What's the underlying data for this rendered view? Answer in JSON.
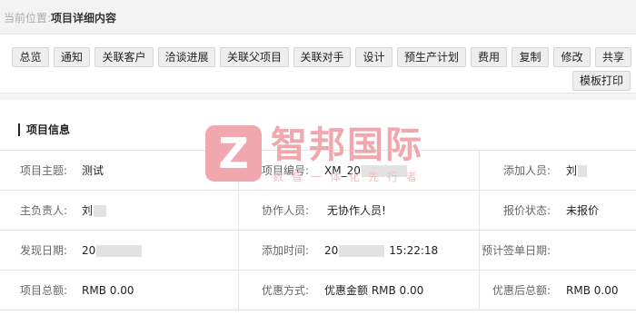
{
  "breadcrumb": {
    "prefix": "当前位置:",
    "current": "项目详细内容"
  },
  "toolbar": {
    "buttons": [
      "总览",
      "通知",
      "关联客户",
      "洽谈进展",
      "关联父项目",
      "关联对手",
      "设计",
      "预生产计划",
      "费用",
      "复制",
      "修改",
      "共享"
    ],
    "print_label": "模板打印"
  },
  "section": {
    "title": "项目信息"
  },
  "fields": {
    "project_subject": {
      "label": "项目主题:",
      "value": "测试"
    },
    "project_code": {
      "label": "项目编号:",
      "value": "XM_20"
    },
    "added_by": {
      "label": "添加人员:",
      "value": "刘"
    },
    "lead_owner": {
      "label": "主负责人:",
      "value": "刘"
    },
    "collaborators": {
      "label": "协作人员:",
      "value": "无协作人员!"
    },
    "quote_status": {
      "label": "报价状态:",
      "value": "未报价"
    },
    "found_date": {
      "label": "发现日期:",
      "value": "20"
    },
    "added_time": {
      "label": "添加时间:",
      "value": "20",
      "value_suffix": "15:22:18"
    },
    "expected_sign_date": {
      "label": "预计签单日期:",
      "value": ""
    },
    "project_total": {
      "label": "项目总额:",
      "value": "RMB 0.00"
    },
    "discount_method": {
      "label": "优惠方式:",
      "value": "优惠金额 RMB 0.00"
    },
    "total_after_discount": {
      "label": "优惠后总额:",
      "value": "RMB 0.00"
    }
  },
  "watermark": {
    "title": "智邦国际",
    "subtitle": "数智一体化先行者"
  },
  "colors": {
    "watermark": "#f0a8ae",
    "toolbar_button_bg": "#eeeeee",
    "border": "#e5e5e5"
  }
}
